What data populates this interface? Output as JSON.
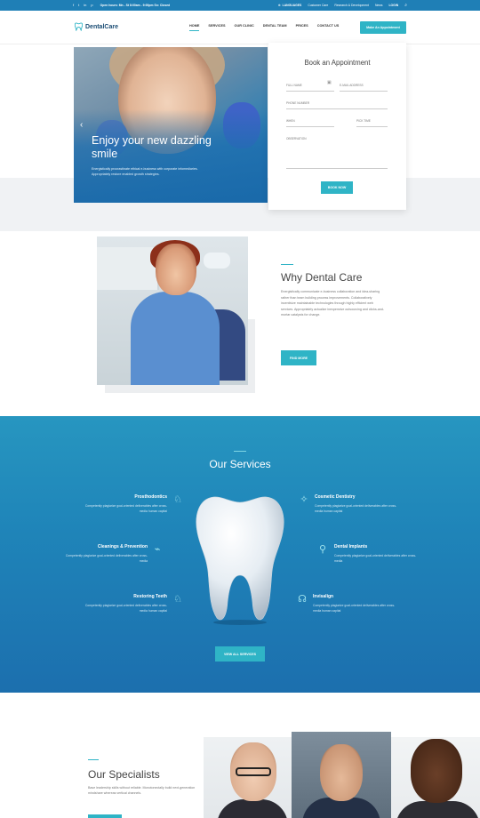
{
  "topbar": {
    "social_icons": [
      "facebook-icon",
      "twitter-icon",
      "linkedin-icon",
      "pinterest-icon"
    ],
    "hours": "Open hours: Mn - St 8:00am - 9:00pm Sn: Closed",
    "language": "LANGUAGES",
    "links": [
      "Customer Care",
      "Research & Development",
      "News",
      "LOGIN"
    ]
  },
  "nav": {
    "brand": "DentalCare",
    "menu": [
      "HOME",
      "SERVICES",
      "OUR CLINIC",
      "DENTAL TEAM",
      "PRICES",
      "CONTACT US"
    ],
    "active_index": 0,
    "cta": "Make An Appointment"
  },
  "hero": {
    "headline": "Enjoy your new dazzling smile",
    "text": "Energistically procrastinate ethical e-business with corporate infomediaries. Appropriately restore enabled growth strategies."
  },
  "booking": {
    "title": "Book an Appointment",
    "full_name": "FULL NAME",
    "email": "E-MAIL ADDRESS",
    "phone": "PHONE NUMBER",
    "when": "WHEN",
    "pick_time": "PICK TIME",
    "observation": "OBSERVATION",
    "button": "BOOK NOW"
  },
  "why": {
    "title": "Why Dental Care",
    "text": "Energistically communicate e-business collaboration and idea-sharing rather than team building process improvements. Collaboratively incentivize maintainable technologies through highly efficient web services. Appropriately actualize inexpensive outsourcing and clicks-and-mortar catalysts for change.",
    "button": "FIND MORE"
  },
  "services": {
    "title": "Our Services",
    "items": [
      {
        "title": "Prosthodontics",
        "text": "Competently plagiarize goal-oriented deliverables after cross-media human capital"
      },
      {
        "title": "Cosmetic Dentistry",
        "text": "Competently plagiarize goal-oriented deliverables after cross-media human capital"
      },
      {
        "title": "Cleanings & Prevention",
        "text": "Competently plagiarize goal-oriented deliverables after cross-media"
      },
      {
        "title": "Dental Implants",
        "text": "Competently plagiarize goal-oriented deliverables after cross-media"
      },
      {
        "title": "Restoring Teeth",
        "text": "Competently plagiarize goal-oriented deliverables after cross-media human capital"
      },
      {
        "title": "Invisalign",
        "text": "Competently plagiarize goal-oriented deliverables after cross-media human capital"
      }
    ],
    "button": "VIEW ALL SERVICES"
  },
  "specialists": {
    "title": "Our Specialists",
    "text": "Base leadership skills without reliable. Monotonectally build next-generation mindshare whereas vertical channels."
  },
  "colors": {
    "accent": "#2fb4c6",
    "topbar": "#1f7fb6",
    "services_bg": "#1f85b9"
  }
}
